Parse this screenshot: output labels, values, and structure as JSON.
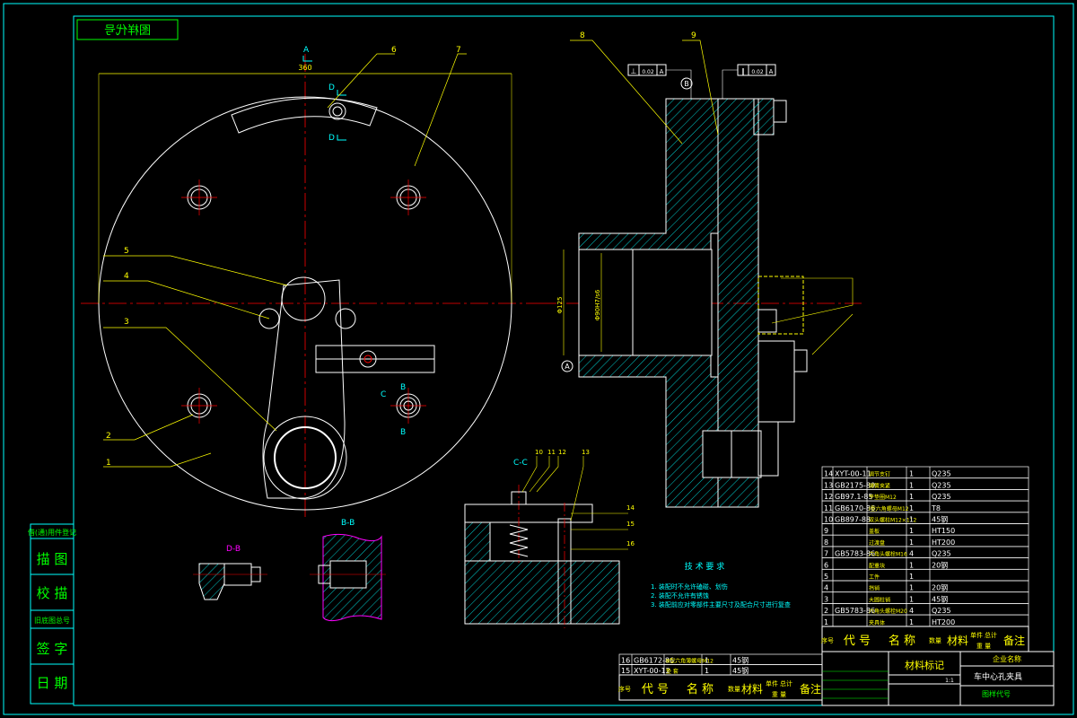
{
  "colors": {
    "background": "#000000",
    "border": "#00ffff",
    "outline": "#ffffff",
    "dims": "#ffff00",
    "center": "#ff0000",
    "table_green": "#00ff00",
    "hatch": "#00ffff",
    "pink": "#ff00ff",
    "blue": "#4aa0ff"
  },
  "title_tag": "图样代号",
  "section_labels": {
    "a_top": "A",
    "d_top": "D",
    "d_bot": "D",
    "c": "C",
    "b_top": "B",
    "b_bot": "B",
    "cc": "C-C",
    "bb": "B-B",
    "db": "D-B",
    "datum_a": "A",
    "datum_b": "B"
  },
  "dimensions": {
    "width_360": "360",
    "dia1": "Φ125",
    "dia2": "Φ90H7/s6"
  },
  "tolerances": [
    {
      "symbol": "⊥",
      "value": "0.02",
      "datum": "A"
    },
    {
      "symbol": "∥",
      "value": "0.02",
      "datum": "A"
    }
  ],
  "balloons": [
    "1",
    "2",
    "3",
    "4",
    "5",
    "6",
    "7",
    "8",
    "9",
    "10",
    "11",
    "12",
    "13",
    "14",
    "15",
    "16"
  ],
  "tech_req": {
    "title": "技 术 要 求",
    "lines": [
      "1. 装配时不允许磕碰、划伤",
      "2. 装配不允许有锈蚀",
      "3. 装配前应对零部件主要尺寸及配合尺寸进行复查"
    ]
  },
  "left_stamps": [
    "借(通)用件登记",
    "描 图",
    "校 描",
    "旧底图总号",
    "签 字",
    "日 期"
  ],
  "parts_right": [
    {
      "no": "14",
      "code": "XYT-00-11",
      "name": "调节支钉",
      "qty": "1",
      "mat": "Q235"
    },
    {
      "no": "13",
      "code": "GB2175-80",
      "name": "弹簧夹紧",
      "qty": "1",
      "mat": "Q235"
    },
    {
      "no": "12",
      "code": "GB97.1-85",
      "name": "平垫圈M12",
      "qty": "1",
      "mat": "Q235"
    },
    {
      "no": "11",
      "code": "GB6170-86",
      "name": "I型六角螺母M12",
      "qty": "1",
      "mat": "T8"
    },
    {
      "no": "10",
      "code": "GB897-88",
      "name": "双头螺柱M12×112",
      "qty": "1",
      "mat": "45钢"
    },
    {
      "no": "9",
      "code": "",
      "name": "盖板",
      "qty": "1",
      "mat": "HT150"
    },
    {
      "no": "8",
      "code": "",
      "name": "过渡盘",
      "qty": "1",
      "mat": "HT200"
    },
    {
      "no": "7",
      "code": "GB5783-86",
      "name": "六角头螺栓M16",
      "qty": "4",
      "mat": "Q235"
    },
    {
      "no": "6",
      "code": "",
      "name": "配重块",
      "qty": "1",
      "mat": "20钢"
    },
    {
      "no": "5",
      "code": "",
      "name": "工件",
      "qty": "1",
      "mat": ""
    },
    {
      "no": "4",
      "code": "",
      "name": "挡销",
      "qty": "1",
      "mat": "20钢"
    },
    {
      "no": "3",
      "code": "",
      "name": "大圆柱销",
      "qty": "1",
      "mat": "45钢"
    },
    {
      "no": "2",
      "code": "GB5783-86",
      "name": "六角头螺栓M20",
      "qty": "4",
      "mat": "Q235"
    },
    {
      "no": "1",
      "code": "",
      "name": "夹具体",
      "qty": "1",
      "mat": "HT200"
    }
  ],
  "parts_header": {
    "no": "序号",
    "code": "代 号",
    "name": "名 称",
    "qty": "数量",
    "mat": "材料",
    "single": "单件",
    "total": "总计",
    "weight": "重 量",
    "remark": "备注"
  },
  "parts_bottom": [
    {
      "no": "16",
      "code": "GB6172-86",
      "name": "Ⅲ型六角薄螺母M12",
      "qty": "1",
      "mat": "45钢"
    },
    {
      "no": "15",
      "code": "XYT-00-12",
      "name": "垫 套",
      "qty": "1",
      "mat": "45钢"
    }
  ],
  "title_block": {
    "company": "企业名称",
    "material_mark": "材料标记",
    "drawing_name": "车中心孔夹具",
    "drawing_code": "图样代号",
    "scale": "1:1"
  }
}
